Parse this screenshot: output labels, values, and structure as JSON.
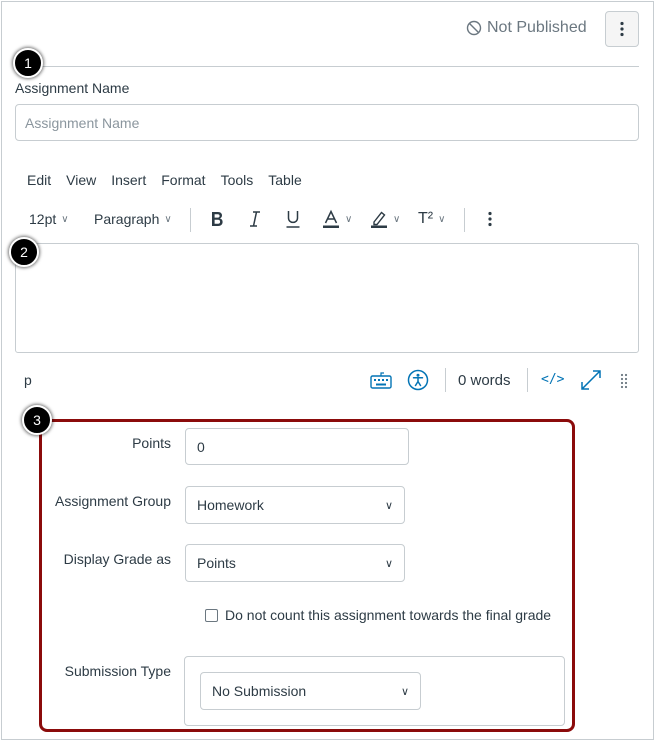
{
  "header": {
    "status_label": "Not Published",
    "status_icon": "not-published-icon",
    "kebab_icon": "kebab-menu-icon"
  },
  "markers": [
    "1",
    "2",
    "3"
  ],
  "assignment_name": {
    "label": "Assignment Name",
    "placeholder": "Assignment Name",
    "value": ""
  },
  "editor": {
    "menu": [
      "Edit",
      "View",
      "Insert",
      "Format",
      "Tools",
      "Table"
    ],
    "font_size": "12pt",
    "block_format": "Paragraph",
    "superscript_label": "T²",
    "path": "p",
    "word_count": "0 words",
    "html_toggle_label": "</>"
  },
  "settings": {
    "points_label": "Points",
    "points_value": "0",
    "group_label": "Assignment Group",
    "group_value": "Homework",
    "display_label": "Display Grade as",
    "display_value": "Points",
    "omit_label": "Do not count this assignment towards the final grade",
    "submission_label": "Submission Type",
    "submission_value": "No Submission"
  },
  "colors": {
    "highlight_border": "#8b0b0b",
    "link_blue": "#0374b5",
    "text": "#2d3b45",
    "muted": "#6b7780"
  }
}
